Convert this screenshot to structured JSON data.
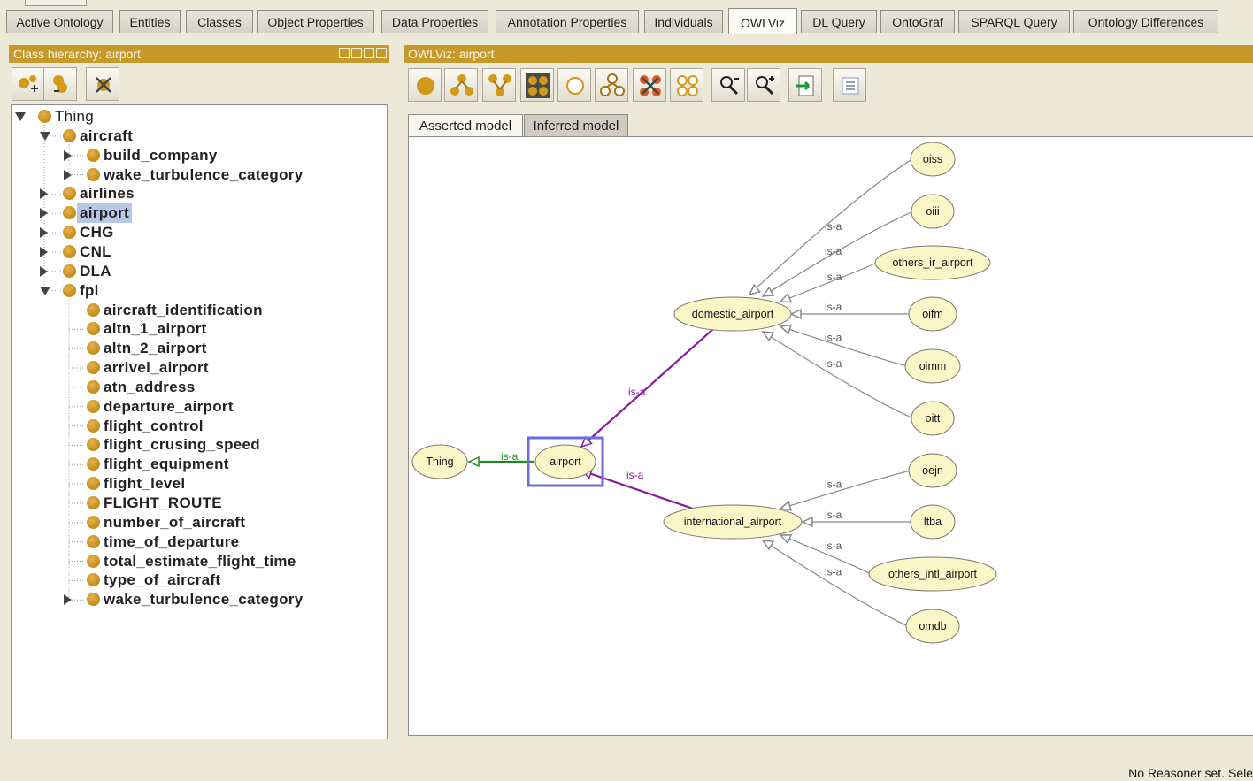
{
  "tabs": [
    {
      "label": "Active Ontology"
    },
    {
      "label": "Entities"
    },
    {
      "label": "Classes"
    },
    {
      "label": "Object Properties"
    },
    {
      "label": "Data Properties"
    },
    {
      "label": "Annotation Properties"
    },
    {
      "label": "Individuals"
    },
    {
      "label": "OWLViz",
      "active": true
    },
    {
      "label": "DL Query"
    },
    {
      "label": "OntoGraf"
    },
    {
      "label": "SPARQL Query"
    },
    {
      "label": "Ontology Differences"
    }
  ],
  "class_panel": {
    "title": "Class hierarchy: airport",
    "toolbar": [
      {
        "icon": "add-subclass-icon"
      },
      {
        "icon": "add-sibling-class-icon"
      },
      {
        "icon": "delete-class-icon"
      }
    ]
  },
  "tree": [
    {
      "label": "Thing",
      "depth": 0,
      "toggle": "down",
      "style": "plain"
    },
    {
      "label": "aircraft",
      "depth": 1,
      "toggle": "down"
    },
    {
      "label": "build_company",
      "depth": 2,
      "toggle": "right"
    },
    {
      "label": "wake_turbulence_category",
      "depth": 2,
      "toggle": "right"
    },
    {
      "label": "airlines",
      "depth": 1,
      "toggle": "right"
    },
    {
      "label": "airport",
      "depth": 1,
      "toggle": "right",
      "selected": true
    },
    {
      "label": "CHG",
      "depth": 1,
      "toggle": "right"
    },
    {
      "label": "CNL",
      "depth": 1,
      "toggle": "right"
    },
    {
      "label": "DLA",
      "depth": 1,
      "toggle": "right"
    },
    {
      "label": "fpl",
      "depth": 1,
      "toggle": "down"
    },
    {
      "label": "aircraft_identification",
      "depth": 2
    },
    {
      "label": "altn_1_airport",
      "depth": 2
    },
    {
      "label": "altn_2_airport",
      "depth": 2
    },
    {
      "label": "arrivel_airport",
      "depth": 2
    },
    {
      "label": "atn_address",
      "depth": 2
    },
    {
      "label": "departure_airport",
      "depth": 2
    },
    {
      "label": "flight_control",
      "depth": 2
    },
    {
      "label": "flight_crusing_speed",
      "depth": 2
    },
    {
      "label": "flight_equipment",
      "depth": 2
    },
    {
      "label": "flight_level",
      "depth": 2
    },
    {
      "label": "FLIGHT_ROUTE",
      "depth": 2
    },
    {
      "label": "number_of_aircraft",
      "depth": 2
    },
    {
      "label": "time_of_departure",
      "depth": 2
    },
    {
      "label": "total_estimate_flight_time",
      "depth": 2
    },
    {
      "label": "type_of_aircraft",
      "depth": 2
    },
    {
      "label": "wake_turbulence_category",
      "depth": 2,
      "toggle": "right"
    }
  ],
  "owlviz": {
    "title": "OWLViz: airport",
    "toolbar": [
      {
        "icon": "show-class-icon"
      },
      {
        "icon": "show-subclasses-icon"
      },
      {
        "icon": "show-superclasses-icon"
      },
      {
        "icon": "show-all-classes-icon"
      },
      {
        "icon": "hide-class-icon"
      },
      {
        "icon": "hide-subclasses-icon"
      },
      {
        "icon": "hide-class-cross-icon"
      },
      {
        "icon": "hide-all-classes-icon"
      },
      {
        "icon": "zoom-out-icon"
      },
      {
        "icon": "zoom-in-icon"
      },
      {
        "icon": "export-icon"
      },
      {
        "icon": "options-icon"
      }
    ],
    "subtabs": [
      {
        "label": "Asserted model",
        "active": true
      },
      {
        "label": "Inferred model"
      }
    ]
  },
  "graph": {
    "edge_label": "is-a",
    "nodes": [
      {
        "id": "Thing",
        "label": "Thing"
      },
      {
        "id": "airport",
        "label": "airport",
        "focused": true
      },
      {
        "id": "domestic_airport",
        "label": "domestic_airport"
      },
      {
        "id": "international_airport",
        "label": "international_airport"
      },
      {
        "id": "oiss",
        "label": "oiss"
      },
      {
        "id": "oiii",
        "label": "oiii"
      },
      {
        "id": "others_ir_airport",
        "label": "others_ir_airport"
      },
      {
        "id": "oifm",
        "label": "oifm"
      },
      {
        "id": "oimm",
        "label": "oimm"
      },
      {
        "id": "oitt",
        "label": "oitt"
      },
      {
        "id": "oejn",
        "label": "oejn"
      },
      {
        "id": "ltba",
        "label": "ltba"
      },
      {
        "id": "others_intl_airport",
        "label": "others_intl_airport"
      },
      {
        "id": "omdb",
        "label": "omdb"
      }
    ],
    "edges": [
      {
        "from": "airport",
        "to": "Thing",
        "color": "#1f8a1f"
      },
      {
        "from": "domestic_airport",
        "to": "airport",
        "color": "#8a1aa0"
      },
      {
        "from": "international_airport",
        "to": "airport",
        "color": "#8a1aa0"
      },
      {
        "from": "oiss",
        "to": "domestic_airport",
        "color": "#888888"
      },
      {
        "from": "oiii",
        "to": "domestic_airport",
        "color": "#888888"
      },
      {
        "from": "others_ir_airport",
        "to": "domestic_airport",
        "color": "#888888"
      },
      {
        "from": "oifm",
        "to": "domestic_airport",
        "color": "#888888"
      },
      {
        "from": "oimm",
        "to": "domestic_airport",
        "color": "#888888"
      },
      {
        "from": "oitt",
        "to": "domestic_airport",
        "color": "#888888"
      },
      {
        "from": "oejn",
        "to": "international_airport",
        "color": "#888888"
      },
      {
        "from": "ltba",
        "to": "international_airport",
        "color": "#888888"
      },
      {
        "from": "others_intl_airport",
        "to": "international_airport",
        "color": "#888888"
      },
      {
        "from": "omdb",
        "to": "international_airport",
        "color": "#888888"
      }
    ]
  },
  "status": "No Reasoner set. Sele"
}
